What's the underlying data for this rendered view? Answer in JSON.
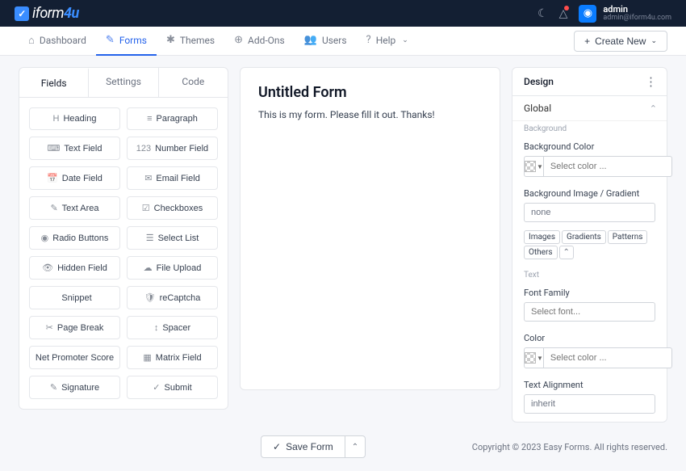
{
  "brand": {
    "text1": "iform",
    "text2": "4u"
  },
  "user": {
    "name": "admin",
    "email": "admin@iform4u.com"
  },
  "nav": {
    "items": [
      {
        "label": "Dashboard",
        "icon": "⌂"
      },
      {
        "label": "Forms",
        "icon": "✎"
      },
      {
        "label": "Themes",
        "icon": "✱"
      },
      {
        "label": "Add-Ons",
        "icon": "⊕"
      },
      {
        "label": "Users",
        "icon": "👥"
      },
      {
        "label": "Help",
        "icon": "?"
      }
    ],
    "create": "Create New"
  },
  "tabs": {
    "fields": "Fields",
    "settings": "Settings",
    "code": "Code"
  },
  "fields": [
    {
      "label": "Heading",
      "icon": "H"
    },
    {
      "label": "Paragraph",
      "icon": "≡"
    },
    {
      "label": "Text Field",
      "icon": "⌨"
    },
    {
      "label": "Number Field",
      "icon": "123"
    },
    {
      "label": "Date Field",
      "icon": "📅"
    },
    {
      "label": "Email Field",
      "icon": "✉"
    },
    {
      "label": "Text Area",
      "icon": "✎"
    },
    {
      "label": "Checkboxes",
      "icon": "☑"
    },
    {
      "label": "Radio Buttons",
      "icon": "◉"
    },
    {
      "label": "Select List",
      "icon": "☰"
    },
    {
      "label": "Hidden Field",
      "icon": "👁"
    },
    {
      "label": "File Upload",
      "icon": "☁"
    },
    {
      "label": "Snippet",
      "icon": "</>"
    },
    {
      "label": "reCaptcha",
      "icon": "🛡"
    },
    {
      "label": "Page Break",
      "icon": "✂"
    },
    {
      "label": "Spacer",
      "icon": "↕"
    },
    {
      "label": "Net Promoter Score",
      "icon": ""
    },
    {
      "label": "Matrix Field",
      "icon": "▦"
    },
    {
      "label": "Signature",
      "icon": "✎"
    },
    {
      "label": "Submit",
      "icon": "✓"
    }
  ],
  "form": {
    "title": "Untitled Form",
    "description": "This is my form. Please fill it out. Thanks!"
  },
  "design": {
    "title": "Design",
    "global": "Global",
    "background_section": "Background",
    "bg_color_label": "Background Color",
    "bg_color_placeholder": "Select color ...",
    "bg_image_label": "Background Image / Gradient",
    "bg_image_value": "none",
    "pills": [
      "Images",
      "Gradients",
      "Patterns",
      "Others"
    ],
    "text_section": "Text",
    "font_family_label": "Font Family",
    "font_family_placeholder": "Select font...",
    "color_label": "Color",
    "color_placeholder": "Select color ...",
    "alignment_label": "Text Alignment",
    "alignment_value": "inherit"
  },
  "footer": {
    "save": "Save Form",
    "copyright": "Copyright © 2023 Easy Forms. All rights reserved."
  }
}
